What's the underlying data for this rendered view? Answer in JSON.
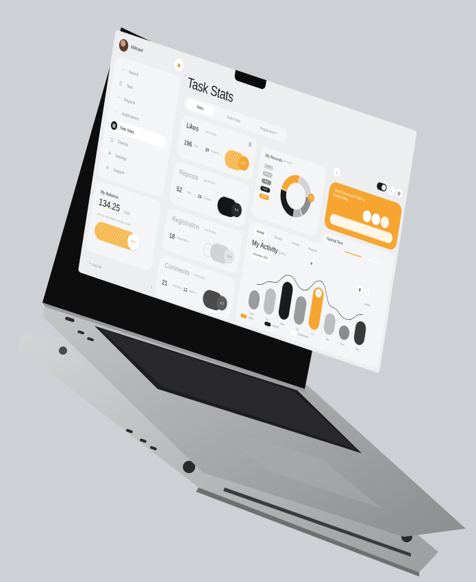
{
  "colors": {
    "background": "#cdd1d5",
    "accent": "#f6a531",
    "dark": "#1b1b1b",
    "panel": "#f4f5f6"
  },
  "user": {
    "name": "Mikhael"
  },
  "sidebar": {
    "items": [
      {
        "label": "Search",
        "icon": "search-icon"
      },
      {
        "label": "Task",
        "icon": "task-icon"
      },
      {
        "label": "Reports",
        "icon": "reports-icon"
      },
      {
        "label": "Notifications",
        "icon": "bell-icon"
      },
      {
        "label": "Task Stats",
        "icon": "stats-icon",
        "active": true
      },
      {
        "label": "Friends",
        "icon": "friends-icon"
      },
      {
        "label": "Settings",
        "icon": "settings-icon"
      },
      {
        "label": "Support",
        "icon": "support-icon"
      }
    ]
  },
  "balance": {
    "title": "My Balance",
    "value": "134.25",
    "unit": "USD",
    "note": "Get your last balance and get a prize",
    "badge": "$12",
    "logout": "Log out"
  },
  "page": {
    "title": "Task Stats",
    "tabs": [
      "Tasks",
      "Stats today",
      "Registrations"
    ]
  },
  "stats": [
    {
      "title": "Likes",
      "sub": "Last 30 days",
      "num": "196",
      "num_label": "Sent",
      "num2": "39",
      "num2_label": "Received",
      "badge": "30.4"
    },
    {
      "title": "Reposts",
      "sub": "Last 30 days",
      "num": "52",
      "num_label": "Sent",
      "num2": "24",
      "num2_label": "Reposts",
      "badge": "6.3"
    },
    {
      "title": "Registration",
      "sub": "Last 30 days",
      "num": "18",
      "num_label": "Registrations",
      "num2": "",
      "num2_label": "",
      "badge": "19.4"
    },
    {
      "title": "Comments",
      "sub": "Last 30 days",
      "num": "21",
      "num_label": "Comments",
      "num2": "13",
      "num2_label": "Replies",
      "badge": "4.3"
    }
  ],
  "records": {
    "title": "My Records",
    "sub": "Last month",
    "legend": [
      "Likes",
      "Reposts",
      "Reg.",
      "Comm.",
      "Tasks"
    ],
    "badge": "54"
  },
  "promo": {
    "text": "You're doing well! Take a break today"
  },
  "optimal": {
    "title": "Optimal Time"
  },
  "activity": {
    "tabs": [
      "Activity",
      "Weekly",
      "Friends",
      "Reports"
    ],
    "title": "My Activity",
    "sub": "Monthly",
    "month": "November 2023",
    "filter": "Levels",
    "legend": [
      "Tasks",
      "Activity",
      "Comments"
    ]
  },
  "chart_data": {
    "type": "bar",
    "categories": [
      "Mon",
      "Tue",
      "Wed",
      "Thu",
      "Fri",
      "Sat",
      "Sun",
      "Mon"
    ],
    "values": [
      40,
      55,
      80,
      60,
      90,
      45,
      30,
      50
    ],
    "highlight_index": 4,
    "highlight_label": "25"
  }
}
